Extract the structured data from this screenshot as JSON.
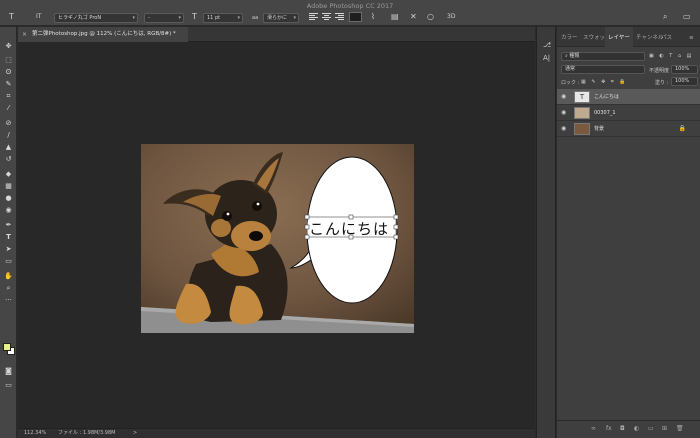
{
  "app": {
    "title": "Adobe Photoshop CC 2017"
  },
  "options_bar": {
    "tool_icon": "T",
    "orientation_icon": "IT",
    "font_family": "ヒラギノ丸ゴ ProN",
    "font_style": "-",
    "font_size": "11 pt",
    "antialias": "滑らかに",
    "antialias_icon": "aa"
  },
  "document": {
    "tab_title": "第二弾Photoshop.jpg @ 112% (こんにちは, RGB/8#) *",
    "tab_close": "×",
    "canvas_text": "こんにちは",
    "zoom": "112.34%",
    "file_info": "ファイル : 1.98M/3.98M",
    "status_arrow": ">"
  },
  "panels": {
    "tabs": [
      "カラー",
      "スウォッ",
      "レイヤー",
      "チャンネル",
      "パス"
    ],
    "active_tab": "レイヤー",
    "filter_kind": "種類",
    "blend_mode": "通常",
    "opacity_label": "不透明度 :",
    "opacity_value": "100%",
    "lock_label": "ロック :",
    "fill_label": "塗り :",
    "fill_value": "100%",
    "layers": [
      {
        "name": "こんにちは",
        "type": "text",
        "thumb": "T",
        "selected": true
      },
      {
        "name": "00307_1",
        "type": "smart",
        "thumb": "",
        "selected": false
      },
      {
        "name": "背景",
        "type": "background",
        "thumb": "",
        "selected": false
      }
    ]
  },
  "colors": {
    "foreground": "#e9ef8a",
    "background": "#ffffff",
    "accent_selected_layer": "#595959"
  },
  "icons": {
    "toolbar": [
      "move-tool",
      "marquee-tool",
      "lasso-tool",
      "quick-select-tool",
      "crop-tool",
      "eyedropper-tool",
      "healing-tool",
      "brush-tool",
      "stamp-tool",
      "history-brush-tool",
      "eraser-tool",
      "gradient-tool",
      "blur-tool",
      "dodge-tool",
      "pen-tool",
      "type-tool",
      "path-select-tool",
      "shape-tool",
      "hand-tool",
      "zoom-tool",
      "more-tools"
    ]
  }
}
